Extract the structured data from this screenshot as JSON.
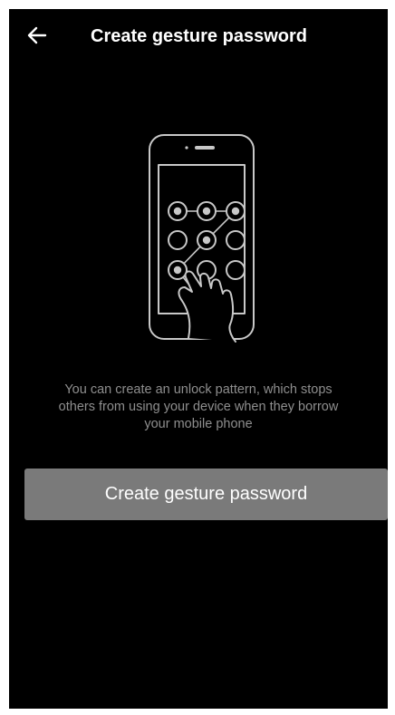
{
  "header": {
    "title": "Create gesture password",
    "back_icon": "arrow-left-icon"
  },
  "illustration": {
    "icon": "phone-unlock-pattern-illustration"
  },
  "description": "You can create an unlock pattern, which stops others from using your device when they borrow your mobile phone",
  "actions": {
    "create_label": "Create gesture password"
  },
  "colors": {
    "background": "#000000",
    "title": "#ffffff",
    "description": "#8e8e8e",
    "button_bg": "#7a7a7a",
    "button_text": "#ffffff"
  }
}
